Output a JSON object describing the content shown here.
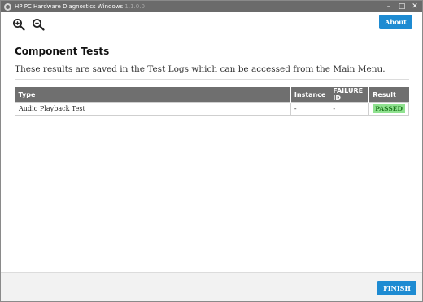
{
  "window": {
    "title": "HP PC Hardware Diagnostics Windows",
    "title_faint": "1.1.0.0",
    "controls": {
      "minimize": "–",
      "maximize": "□",
      "close": "✕"
    }
  },
  "toolbar": {
    "zoom_in_icon": "zoom-in",
    "zoom_out_icon": "zoom-out",
    "about_label": "About"
  },
  "main": {
    "heading": "Component Tests",
    "description": "These results are saved in the Test Logs which can be accessed from the Main Menu.",
    "table": {
      "headers": [
        "Type",
        "Instance",
        "FAILURE ID",
        "Result"
      ],
      "rows": [
        {
          "type": "Audio Playback Test",
          "instance": "-",
          "failure_id": "-",
          "result": "PASSED"
        }
      ]
    }
  },
  "footer": {
    "finish_label": "FINISH"
  },
  "colors": {
    "accent": "#1e8bd2",
    "titlebar": "#6b6b6b",
    "table_header": "#6f6f6f",
    "passed_bg": "#8fe28f",
    "passed_text": "#1f7a1f"
  }
}
